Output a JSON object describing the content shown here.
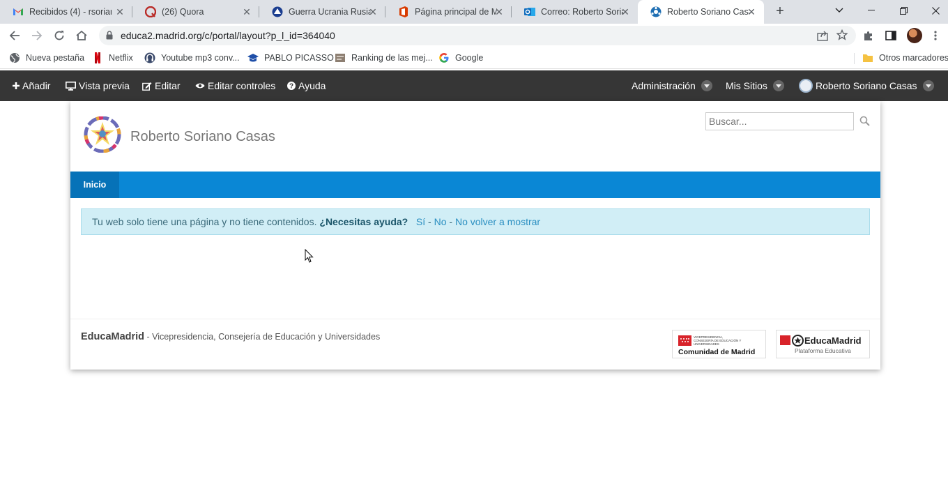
{
  "browser": {
    "tabs": [
      {
        "title": "Recibidos (4) - rsorian",
        "icon": "gmail-icon"
      },
      {
        "title": "(26) Quora",
        "icon": "quora-icon"
      },
      {
        "title": "Guerra Ucrania Rusia:",
        "icon": "news-icon"
      },
      {
        "title": "Página principal de M",
        "icon": "office-icon"
      },
      {
        "title": "Correo: Roberto Soria",
        "icon": "outlook-icon"
      },
      {
        "title": "Roberto Soriano Casa",
        "icon": "liferay-icon",
        "active": true
      }
    ],
    "url": "educa2.madrid.org/c/portal/layout?p_l_id=364040",
    "bookmarks": [
      {
        "label": "Nueva pestaña",
        "icon": "globe-icon"
      },
      {
        "label": "Netflix",
        "icon": "netflix-icon"
      },
      {
        "label": "Youtube mp3 conv...",
        "icon": "youtube-mp3-icon"
      },
      {
        "label": "PABLO PICASSO",
        "icon": "mortarboard-icon"
      },
      {
        "label": "Ranking de las mej...",
        "icon": "page-icon"
      },
      {
        "label": "Google",
        "icon": "google-icon"
      }
    ],
    "other_bookmarks": "Otros marcadores"
  },
  "dockbar": {
    "add": "Añadir",
    "preview": "Vista previa",
    "edit": "Editar",
    "edit_controls": "Editar controles",
    "help": "Ayuda",
    "admin": "Administración",
    "my_sites": "Mis Sitios",
    "user": "Roberto Soriano Casas"
  },
  "site": {
    "name": "Roberto Soriano Casas",
    "search_placeholder": "Buscar...",
    "nav": [
      "Inicio"
    ]
  },
  "alert": {
    "text": "Tu web solo tiene una página y no tiene contenidos.",
    "question": "¿Necesitas ayuda?",
    "yes": "Sí",
    "no": "No",
    "never": "No volver a mostrar",
    "sep": " - "
  },
  "footer": {
    "brand": "EducaMadrid",
    "text": " - Vicepresidencia, Consejería de Educación y Universidades",
    "logo1_small": "VICEPRESIDENCIA, CONSEJERÍA DE EDUCACIÓN Y UNIVERSIDADES",
    "logo1_name": "Comunidad de Madrid",
    "logo2_name": "EducaMadrid",
    "logo2_sub": "Plataforma Educativa"
  },
  "colors": {
    "dockbar": "#363636",
    "nav": "#0a87d5",
    "nav_active": "#0672b8",
    "alert_bg": "#d1eef6"
  }
}
